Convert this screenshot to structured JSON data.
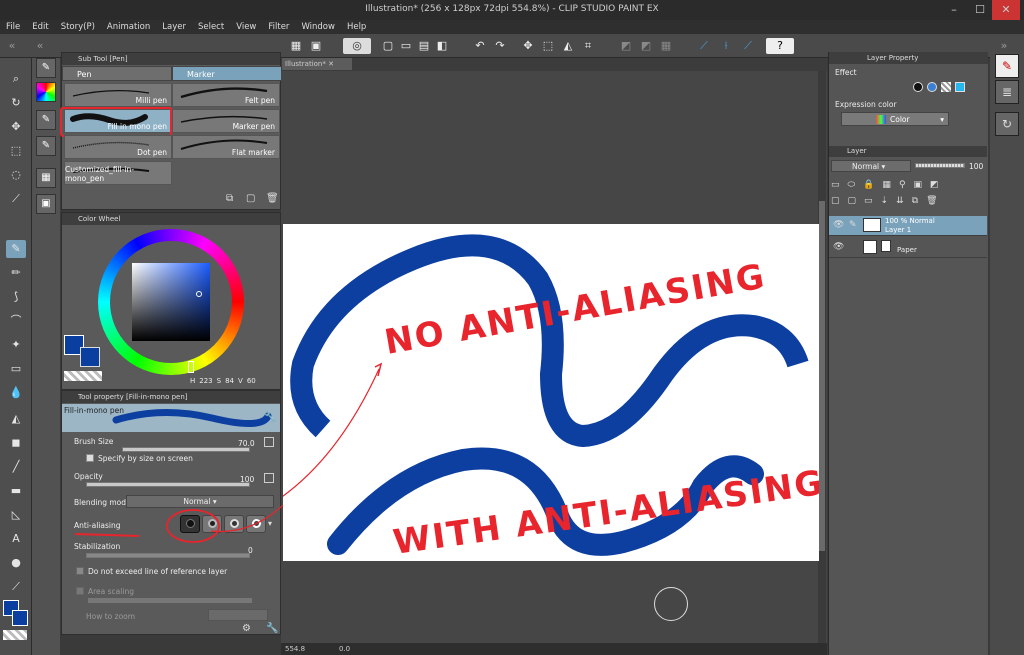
{
  "window": {
    "title": "Illustration* (256 x 128px 72dpi 554.8%) - CLIP STUDIO PAINT EX"
  },
  "menu": [
    "File",
    "Edit",
    "Story(P)",
    "Animation",
    "Layer",
    "Select",
    "View",
    "Filter",
    "Window",
    "Help"
  ],
  "sub_tool": {
    "panel_title": "Sub Tool [Pen]",
    "tabs": [
      "Pen",
      "Marker"
    ],
    "brushes": [
      "Milli pen",
      "Felt pen",
      "Fill in mono pen",
      "Marker pen",
      "Dot pen",
      "Flat marker",
      "Customized_fill-in-mono_pen"
    ]
  },
  "color_wheel": {
    "panel_title": "Color Wheel",
    "h": "223",
    "s": "84",
    "v": "60",
    "main_color": "#0a3fa0"
  },
  "tool_property": {
    "panel_title": "Tool property [Fill-in-mono pen]",
    "tool_name": "Fill-in-mono pen",
    "brush_size_label": "Brush Size",
    "brush_size_value": "70.0",
    "specify_label": "Specify by size on screen",
    "opacity_label": "Opacity",
    "opacity_value": "100",
    "blending_label": "Blending mode",
    "blending_value": "Normal",
    "antialiasing_label": "Anti-aliasing",
    "stabilization_label": "Stabilization",
    "stabilization_value": "0",
    "reference_label": "Do not exceed line of reference layer",
    "area_scaling_label": "Area scaling",
    "how_to_zoom_label": "How to zoom"
  },
  "canvas": {
    "doc_tab": "Illustration*",
    "annotation_top": "NO ANTI-ALIASING",
    "annotation_bottom": "WITH ANTI-ALIASING",
    "zoom_status": "554.8",
    "angle_status": "0.0"
  },
  "layer_property": {
    "panel_title": "Layer Property",
    "effect_label": "Effect",
    "expression_label": "Expression color",
    "expression_value": "Color"
  },
  "layer_panel": {
    "panel_title": "Layer",
    "blend_mode": "Normal",
    "opacity": "100",
    "layers": [
      {
        "info": "100 % Normal",
        "name": "Layer 1"
      },
      {
        "info": "",
        "name": "Paper"
      }
    ]
  },
  "colors": {
    "stroke_blue": "#0d3fa0",
    "annotation_red": "#e8242c",
    "selected_tab": "#7aa2bb"
  }
}
